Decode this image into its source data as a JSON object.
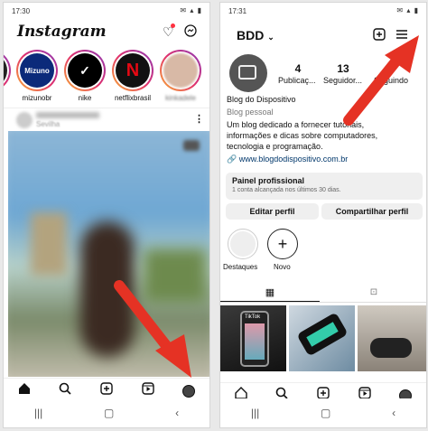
{
  "left": {
    "status_time": "17:30",
    "logo": "Instagram",
    "stories": [
      {
        "label": "mizunobr",
        "brand": "Mizuno",
        "color": "#0b2a7a"
      },
      {
        "label": "nike",
        "brand": "✓",
        "color": "#000"
      },
      {
        "label": "netflixbrasil",
        "brand": "N",
        "color": "#111"
      },
      {
        "label": "kinkadele",
        "brand": "",
        "color": "#d8b9a6"
      }
    ],
    "post_location": "Sevilha"
  },
  "right": {
    "status_time": "17:31",
    "username": "BDD",
    "posts_count": "4",
    "posts_label": "Publicaç...",
    "followers_count": "13",
    "followers_label": "Seguidor...",
    "following_label": "Seguindo",
    "profile_name": "Blog do Dispositivo",
    "category": "Blog pessoal",
    "bio_lines": [
      "Um blog dedicado a fornecer tutoriais,",
      "informações e dicas sobre computadores,",
      "tecnologia e programação."
    ],
    "website": "www.blogdodispositivo.com.br",
    "dashboard_title": "Painel profissional",
    "dashboard_sub": "1 conta alcançada nos últimos 30 dias.",
    "edit_profile": "Editar perfil",
    "share_profile": "Compartilhar perfil",
    "highlight_label": "Destaques",
    "new_label": "Novo",
    "tiktok_label": "TikTok"
  },
  "colors": {
    "accent": "#e53224",
    "link": "#00376b"
  }
}
